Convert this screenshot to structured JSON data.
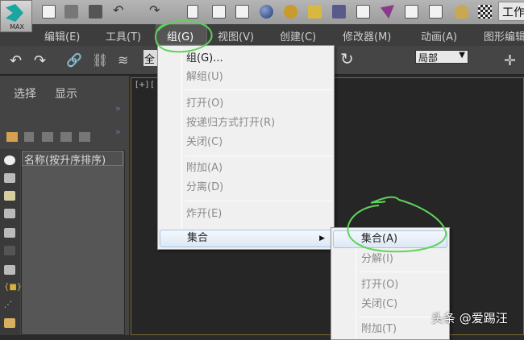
{
  "app": {
    "logo_text": "MAX",
    "workspace_label": "工作"
  },
  "menubar": {
    "items": [
      "编辑(E)",
      "工具(T)",
      "组(G)",
      "视图(V)",
      "创建(C)",
      "修改器(M)",
      "动画(A)",
      "图形编辑"
    ],
    "active_index": 2
  },
  "toolbar": {
    "selection_filter": "全",
    "coord_system": "局部",
    "undo": "↶",
    "redo": "↷"
  },
  "command_panel": {
    "tabs": [
      "选择",
      "显示"
    ],
    "expand": "»",
    "list_header": "名称(按升序排序)"
  },
  "viewport": {
    "label": "[+] ["
  },
  "group_menu": {
    "items": [
      {
        "label": "组(G)...",
        "enabled": true
      },
      {
        "label": "解组(U)",
        "enabled": false
      },
      {
        "label": "打开(O)",
        "enabled": false
      },
      {
        "label": "按递归方式打开(R)",
        "enabled": false
      },
      {
        "label": "关闭(C)",
        "enabled": false
      },
      {
        "label": "附加(A)",
        "enabled": false
      },
      {
        "label": "分离(D)",
        "enabled": false
      },
      {
        "label": "炸开(E)",
        "enabled": false
      },
      {
        "label": "集合",
        "enabled": true,
        "submenu": true,
        "highlighted": true
      }
    ]
  },
  "assembly_submenu": {
    "items": [
      {
        "label": "集合(A)",
        "enabled": true,
        "highlighted": true
      },
      {
        "label": "分解(I)",
        "enabled": false
      },
      {
        "label": "打开(O)",
        "enabled": false
      },
      {
        "label": "关闭(C)",
        "enabled": false
      },
      {
        "label": "附加(T)",
        "enabled": false
      }
    ]
  },
  "watermark": "头条 @爱踢汪",
  "colors": {
    "annotation": "#5fd35a",
    "menu_bg": "#f0f0f0",
    "menubar_bg": "#3d3d3d"
  }
}
